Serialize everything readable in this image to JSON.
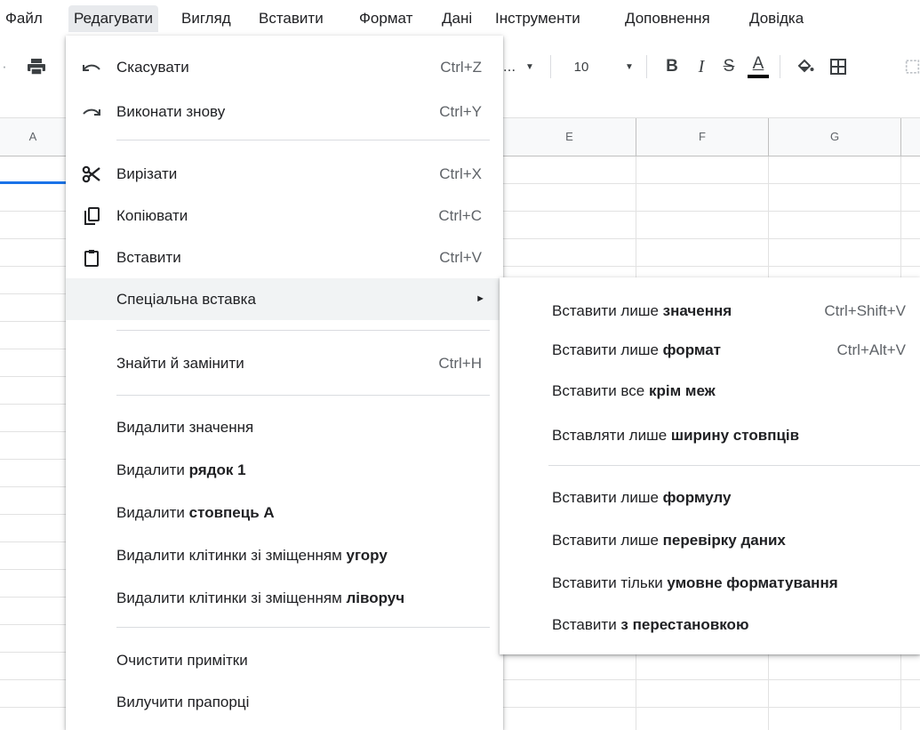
{
  "menubar": [
    "Файл",
    "Редагувати",
    "Вигляд",
    "Вставити",
    "Формат",
    "Дані",
    "Інструменти",
    "Доповнення",
    "Довідка"
  ],
  "toolbar": {
    "font_name": "...",
    "font_size": "10",
    "bold": "B",
    "italic": "I",
    "strike": "S",
    "text_color": "A"
  },
  "columns": [
    "A",
    "E",
    "F",
    "G"
  ],
  "menu": {
    "undo": {
      "label": "Скасувати",
      "shortcut": "Ctrl+Z"
    },
    "redo": {
      "label": "Виконати знову",
      "shortcut": "Ctrl+Y"
    },
    "cut": {
      "label": "Вирізати",
      "shortcut": "Ctrl+X"
    },
    "copy": {
      "label": "Копіювати",
      "shortcut": "Ctrl+C"
    },
    "paste": {
      "label": "Вставити",
      "shortcut": "Ctrl+V"
    },
    "paste_special": {
      "label": "Спеціальна вставка",
      "arrow": "►"
    },
    "find_replace": {
      "label": "Знайти й замінити",
      "shortcut": "Ctrl+H"
    },
    "delete_values": {
      "label": "Видалити значення"
    },
    "delete_row": {
      "label": "Видалити ",
      "bold": "рядок 1"
    },
    "delete_column": {
      "label": "Видалити ",
      "bold": "стовпець A"
    },
    "delete_cells_up": {
      "label": "Видалити клітинки зі зміщенням ",
      "bold": "угору"
    },
    "delete_cells_left": {
      "label": "Видалити клітинки зі зміщенням ",
      "bold": "ліворуч"
    },
    "clear_notes": {
      "label": "Очистити примітки"
    },
    "remove_checkboxes": {
      "label": "Вилучити прапорці"
    }
  },
  "submenu": {
    "values_only": {
      "label": "Вставити лише ",
      "bold": "значення",
      "shortcut": "Ctrl+Shift+V"
    },
    "format_only": {
      "label": "Вставити лише ",
      "bold": "формат",
      "shortcut": "Ctrl+Alt+V"
    },
    "all_except_borders": {
      "label": "Вставити все ",
      "bold": "крім меж"
    },
    "column_width_only": {
      "label": "Вставляти лише ",
      "bold": "ширину стовпців"
    },
    "formula_only": {
      "label": "Вставити лише ",
      "bold": "формулу"
    },
    "data_validation_only": {
      "label": "Вставити лише ",
      "bold": "перевірку даних"
    },
    "conditional_formatting_only": {
      "label": "Вставити тільки ",
      "bold": "умовне форматування"
    },
    "transposed": {
      "label": "Вставити ",
      "bold": "з перестановкою"
    }
  },
  "colors": {
    "accent": "#1a73e8",
    "hover": "#f1f3f4",
    "menubar_active": "#e8eaed"
  }
}
